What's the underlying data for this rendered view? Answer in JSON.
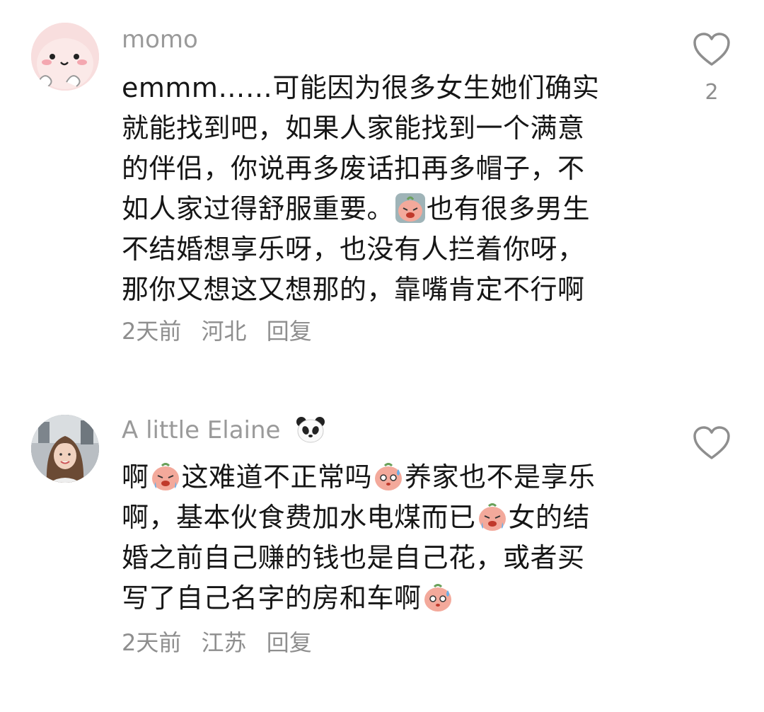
{
  "comments": [
    {
      "username": "momo",
      "lines": [
        "emmm……可能因为很多女生她们确实",
        "就能找到吧，如果人家能找到一个满意",
        "的伴侣，你说再多废话扣再多帽子，不",
        [
          "如人家过得舒服重要。",
          "crying-emoji",
          "也有很多男生"
        ],
        "不结婚想享乐呀，也没有人拦着你呀，",
        "那你又想这又想那的，靠嘴肯定不行啊"
      ],
      "line1": "emmm……可能因为很多女生她们确实",
      "line2": "就能找到吧，如果人家能找到一个满意",
      "line3": "的伴侣，你说再多废话扣再多帽子，不",
      "line4a": "如人家过得舒服重要。",
      "line4b": "也有很多男生",
      "line5": "不结婚想享乐呀，也没有人拦着你呀，",
      "line6": "那你又想这又想那的，靠嘴肯定不行啊",
      "time": "2天前",
      "location": "河北",
      "reply_label": "回复",
      "like_count": "2"
    },
    {
      "username": "A little Elaine",
      "username_icon": "panda-emoji",
      "l1a": "啊",
      "l1b": "这难道不正常吗",
      "l1c": "养家也不是享乐",
      "l2a": "啊，基本伙食费加水电煤而已",
      "l2b": "女的结",
      "l3": "婚之前自己赚的钱也是自己花，或者买",
      "l4": "写了自己名字的房和车啊",
      "time": "2天前",
      "location": "江苏",
      "reply_label": "回复"
    }
  ],
  "icons": {
    "like": "heart-outline-icon",
    "emoji_cry": "crying-peach-emoji",
    "emoji_sweat": "sweating-peach-emoji"
  },
  "colors": {
    "text": "#161616",
    "secondary": "#9a9a9a",
    "emoji_peach": "#f3a99b"
  }
}
